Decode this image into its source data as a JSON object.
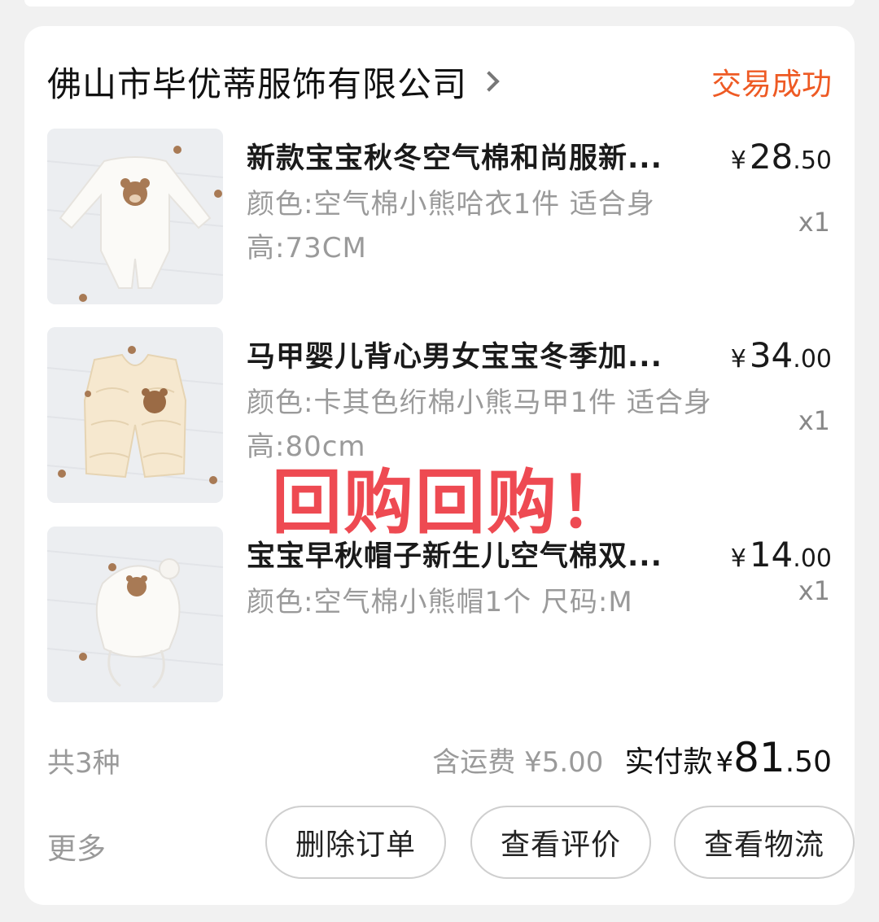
{
  "colors": {
    "accent": "#ee5a24",
    "stamp": "#ee4a52",
    "muted": "#9a9a9a"
  },
  "shop": {
    "name": "佛山市毕优蒂服饰有限公司",
    "status": "交易成功",
    "chevron_icon": "chevron-right-icon"
  },
  "items": [
    {
      "title": "新款宝宝秋冬空气棉和尚服新...",
      "spec_line1": "颜色:空气棉小熊哈衣1件 适合身",
      "spec_line2": "高:73CM",
      "price_yen": "¥",
      "price_int": "28",
      "price_dec": ".50",
      "qty": "x1",
      "thumb": "bear-romper-image"
    },
    {
      "title": "马甲婴儿背心男女宝宝冬季加...",
      "spec_line1": "颜色:卡其色绗棉小熊马甲1件 适合身",
      "spec_line2": "高:80cm",
      "price_yen": "¥",
      "price_int": "34",
      "price_dec": ".00",
      "qty": "x1",
      "thumb": "bear-vest-image"
    },
    {
      "title": "宝宝早秋帽子新生儿空气棉双...",
      "spec_line1": "颜色:空气棉小熊帽1个 尺码:M",
      "spec_line2": "",
      "price_yen": "¥",
      "price_int": "14",
      "price_dec": ".00",
      "qty": "x1",
      "thumb": "bear-hat-image"
    }
  ],
  "stamp_text": "回购回购！",
  "summary": {
    "count": "共3种",
    "shipping": "含运费 ¥5.00",
    "paid_label": "实付款",
    "paid_yen": "¥",
    "paid_int": "81",
    "paid_dec": ".50"
  },
  "actions": {
    "more": "更多",
    "delete": "删除订单",
    "review": "查看评价",
    "logistics": "查看物流"
  }
}
